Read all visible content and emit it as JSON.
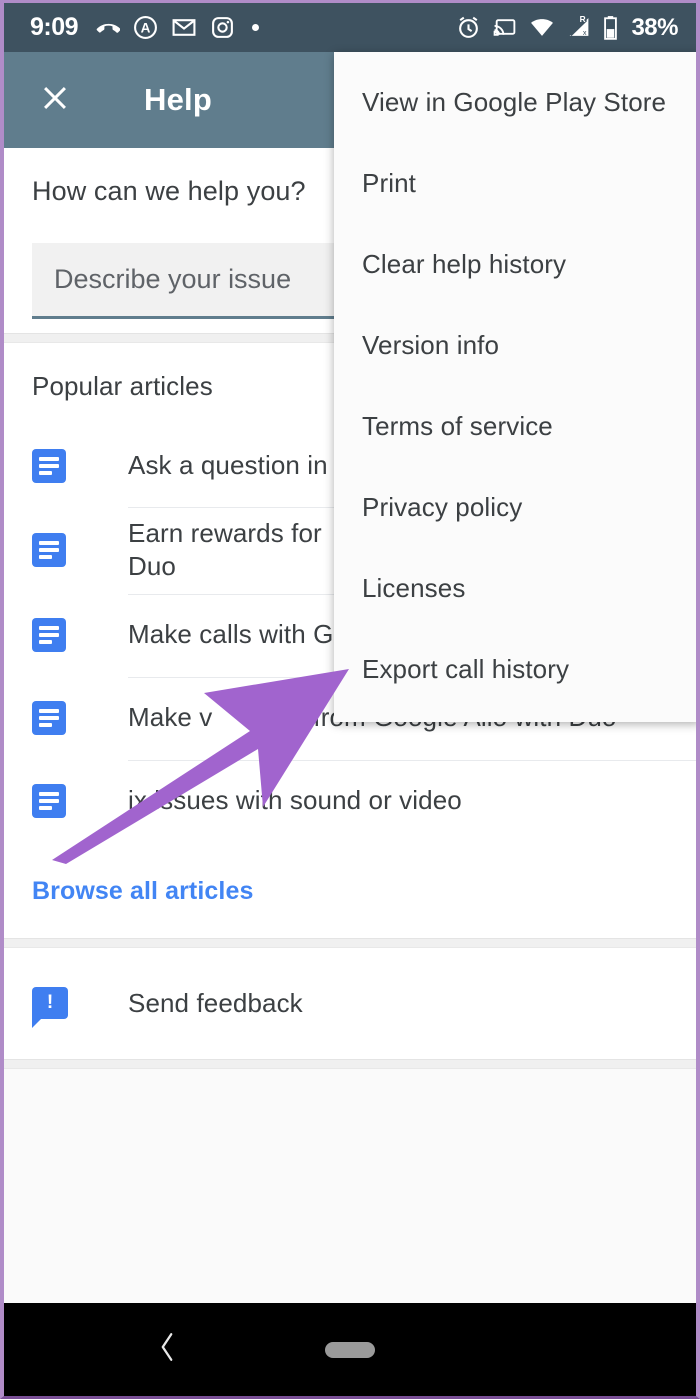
{
  "status_bar": {
    "time": "9:09",
    "battery_percent": "38%",
    "left_icons": [
      "missed-call-icon",
      "adblock-icon",
      "gmail-icon",
      "instagram-icon",
      "notification-dot-icon"
    ],
    "right_icons": [
      "alarm-icon",
      "cast-icon",
      "wifi-icon",
      "cellular-signal-roaming-icon",
      "battery-icon"
    ],
    "background_color": "#3e5260"
  },
  "app_bar": {
    "close_icon": "close-icon",
    "title": "Help",
    "background_color": "#607d8d"
  },
  "search": {
    "heading": "How can we help you?",
    "placeholder": "Describe your issue",
    "value": "",
    "underline_color": "#607d8d"
  },
  "articles": {
    "heading": "Popular articles",
    "items": [
      {
        "icon": "article-icon",
        "title": "Ask a question in"
      },
      {
        "icon": "article-icon",
        "title": "Earn rewards for\nDuo"
      },
      {
        "icon": "article-icon",
        "title": "Make calls with G"
      },
      {
        "icon": "article-icon",
        "title": "Make v           s from Google Allo with Duo"
      },
      {
        "icon": "article-icon",
        "title": "ix issues with sound or video"
      }
    ],
    "browse_all_label": "Browse all articles",
    "browse_all_color": "#4285f4"
  },
  "feedback": {
    "icon": "feedback-bubble-icon",
    "label": "Send feedback"
  },
  "overflow_menu": {
    "items": [
      "View in Google Play Store",
      "Print",
      "Clear help history",
      "Version info",
      "Terms of service",
      "Privacy policy",
      "Licenses",
      "Export call history"
    ]
  },
  "annotation": {
    "shape": "arrow",
    "color": "#a164ce",
    "points_to": "Export call history"
  },
  "nav_bar": {
    "back_icon": "back-chevron-icon",
    "home_icon": "home-pill-icon",
    "background_color": "#000000"
  }
}
